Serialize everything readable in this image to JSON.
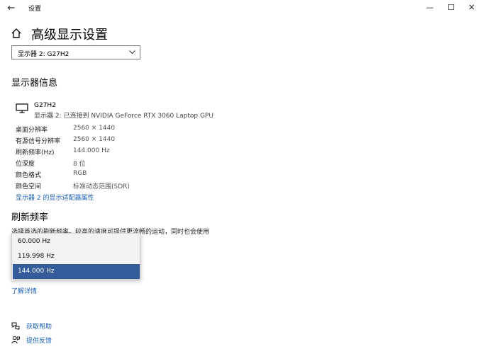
{
  "window": {
    "back_glyph": "←",
    "title": "设置",
    "minimize_glyph": "—",
    "maximize_glyph": "☐",
    "close_glyph": "✕"
  },
  "header": {
    "title": "高级显示设置"
  },
  "display_select": {
    "selected": "显示器 2: G27H2"
  },
  "display_info": {
    "heading": "显示器信息",
    "monitor_name": "G27H2",
    "monitor_sub": "显示器 2: 已连接到 NVIDIA GeForce RTX 3060 Laptop GPU",
    "rows": [
      {
        "label": "桌面分辨率",
        "value": "2560 × 1440"
      },
      {
        "label": "有源信号分辨率",
        "value": "2560 × 1440"
      },
      {
        "label": "刷新频率(Hz)",
        "value": "144.000 Hz"
      },
      {
        "label": "位深度",
        "value": "8 位"
      },
      {
        "label": "颜色格式",
        "value": "RGB"
      },
      {
        "label": "颜色空间",
        "value": "标准动态范围(SDR)"
      }
    ],
    "adapter_link": "显示器 2 的显示适配器属性"
  },
  "refresh": {
    "heading": "刷新频率",
    "description": "选择首选的刷新频率。较高的速度可提供更流畅的运动，同时也会使用",
    "options": [
      "60.000 Hz",
      "119.998 Hz",
      "144.000 Hz"
    ],
    "selected_index": 2,
    "learn_more": "了解详情"
  },
  "help": {
    "get_help": "获取帮助",
    "feedback": "提供反馈"
  }
}
